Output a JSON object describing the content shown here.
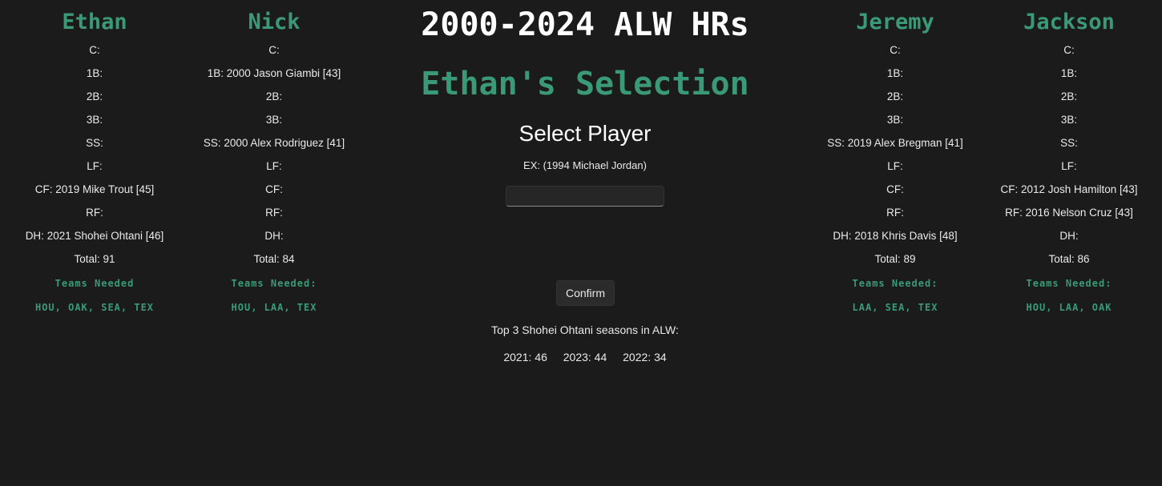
{
  "title": "2000-2024 ALW HRs",
  "selection_title": "Ethan's Selection",
  "select_heading": "Select Player",
  "example_text": "EX: (1994 Michael Jordan)",
  "input": {
    "value": "",
    "placeholder": ""
  },
  "confirm_label": "Confirm",
  "top3": {
    "label": "Top 3 Shohei Ohtani seasons in ALW:",
    "seasons": [
      "2021: 46",
      "2023: 44",
      "2022: 34"
    ]
  },
  "players": [
    {
      "name": "Ethan",
      "positions": [
        "C:",
        "1B:",
        "2B:",
        "3B:",
        "SS:",
        "LF:",
        "CF: 2019 Mike Trout [45]",
        "RF:",
        "DH: 2021 Shohei Ohtani [46]"
      ],
      "total": "Total: 91",
      "teams_label": "Teams Needed",
      "teams": "HOU, OAK, SEA, TEX"
    },
    {
      "name": "Nick",
      "positions": [
        "C:",
        "1B: 2000 Jason Giambi [43]",
        "2B:",
        "3B:",
        "SS: 2000 Alex Rodriguez [41]",
        "LF:",
        "CF:",
        "RF:",
        "DH:"
      ],
      "total": "Total: 84",
      "teams_label": "Teams Needed:",
      "teams": "HOU, LAA, TEX"
    },
    {
      "name": "Jeremy",
      "positions": [
        "C:",
        "1B:",
        "2B:",
        "3B:",
        "SS: 2019 Alex Bregman [41]",
        "LF:",
        "CF:",
        "RF:",
        "DH: 2018 Khris Davis [48]"
      ],
      "total": "Total: 89",
      "teams_label": "Teams Needed:",
      "teams": "LAA, SEA, TEX"
    },
    {
      "name": "Jackson",
      "positions": [
        "C:",
        "1B:",
        "2B:",
        "3B:",
        "SS:",
        "LF:",
        "CF: 2012 Josh Hamilton [43]",
        "RF: 2016 Nelson Cruz [43]",
        "DH:"
      ],
      "total": "Total: 86",
      "teams_label": "Teams Needed:",
      "teams": "HOU, LAA, OAK"
    }
  ],
  "colors": {
    "background": "#1b1b1b",
    "accent": "#3a9a78",
    "text": "#eaeaea"
  }
}
